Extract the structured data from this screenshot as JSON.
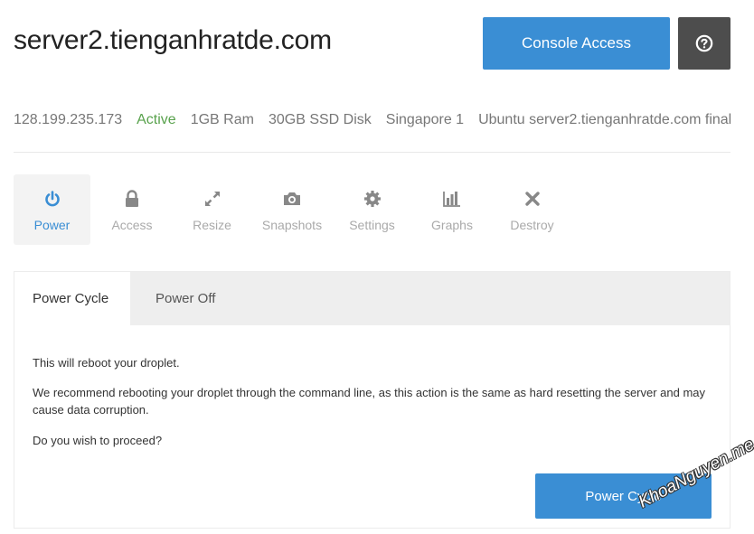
{
  "header": {
    "title": "server2.tienganhratde.com",
    "console_label": "Console Access",
    "help_icon": "question-circle-icon"
  },
  "meta": {
    "ip": "128.199.235.173",
    "status": "Active",
    "ram": "1GB Ram",
    "disk": "30GB SSD Disk",
    "region": "Singapore 1",
    "image": "Ubuntu server2.tienganhratde.com final"
  },
  "nav": {
    "items": [
      {
        "label": "Power",
        "icon": "power-icon",
        "active": true
      },
      {
        "label": "Access",
        "icon": "lock-icon"
      },
      {
        "label": "Resize",
        "icon": "resize-arrows-icon"
      },
      {
        "label": "Snapshots",
        "icon": "camera-icon"
      },
      {
        "label": "Settings",
        "icon": "gear-icon"
      },
      {
        "label": "Graphs",
        "icon": "bar-chart-icon"
      },
      {
        "label": "Destroy",
        "icon": "close-x-icon"
      }
    ]
  },
  "panel": {
    "tabs": [
      {
        "label": "Power Cycle",
        "active": true
      },
      {
        "label": "Power Off"
      }
    ],
    "text1": "This will reboot your droplet.",
    "text2": "We recommend rebooting your droplet through the command line, as this action is the same as hard resetting the server and may cause data corruption.",
    "text3": "Do you wish to proceed?",
    "button_label": "Power Cycle"
  },
  "watermark": "KhoaNguyen.me",
  "colors": {
    "accent": "#3a8ed4",
    "active_status": "#59a24d",
    "help_button": "#4d4d4d"
  }
}
